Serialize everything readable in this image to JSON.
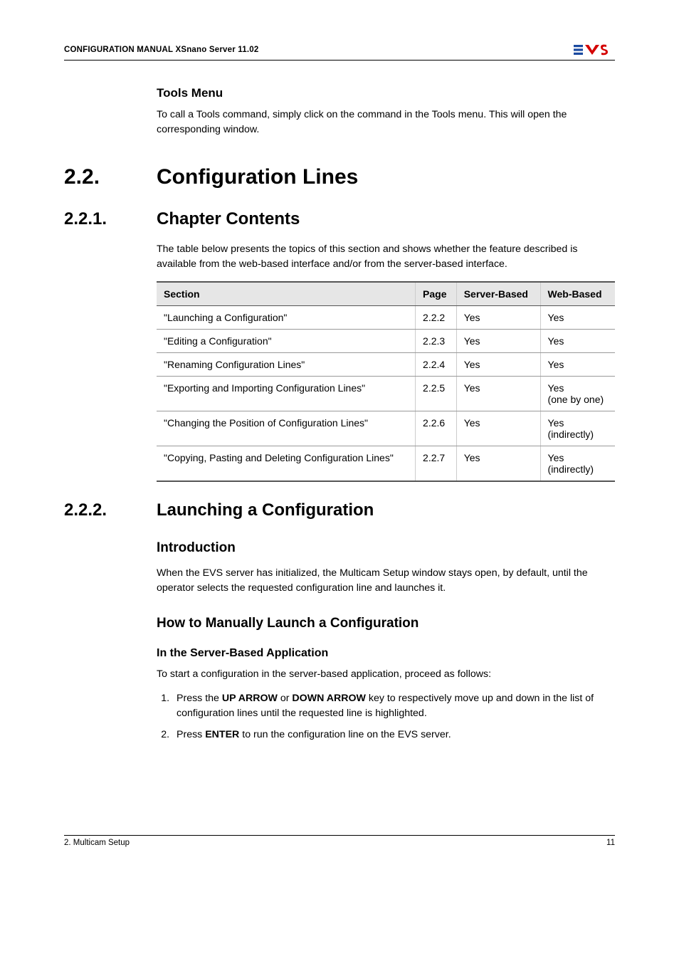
{
  "header": {
    "title": "CONFIGURATION MANUAL  XSnano Server 11.02"
  },
  "tools": {
    "heading": "Tools Menu",
    "body": "To call a Tools command, simply click on the command in the Tools menu. This will open the corresponding window."
  },
  "s22": {
    "num": "2.2.",
    "title": "Configuration Lines"
  },
  "s221": {
    "num": "2.2.1.",
    "title": "Chapter Contents",
    "intro": "The table below presents the topics of this section and shows whether the feature described is available from the web-based interface and/or from the server-based interface.",
    "table": {
      "headers": [
        "Section",
        "Page",
        "Server-Based",
        "Web-Based"
      ],
      "rows": [
        {
          "c0": "\"Launching a Configuration\"",
          "c1": "2.2.2",
          "c2": "Yes",
          "c3": "Yes"
        },
        {
          "c0": "\"Editing a Configuration\"",
          "c1": "2.2.3",
          "c2": "Yes",
          "c3": "Yes"
        },
        {
          "c0": "\"Renaming Configuration Lines\"",
          "c1": "2.2.4",
          "c2": "Yes",
          "c3": "Yes"
        },
        {
          "c0": "\"Exporting and Importing Configuration Lines\"",
          "c1": "2.2.5",
          "c2": "Yes",
          "c3a": "Yes",
          "c3b": "(one by one)"
        },
        {
          "c0": "\"Changing the Position of Configuration Lines\"",
          "c1": "2.2.6",
          "c2": "Yes",
          "c3a": "Yes",
          "c3b": "(indirectly)"
        },
        {
          "c0": "\"Copying, Pasting and Deleting Configuration Lines\"",
          "c1": "2.2.7",
          "c2": "Yes",
          "c3a": "Yes",
          "c3b": "(indirectly)"
        }
      ]
    }
  },
  "s222": {
    "num": "2.2.2.",
    "title": "Launching a Configuration",
    "intro_h": "Introduction",
    "intro_body": "When the EVS server has initialized, the Multicam Setup window stays open, by default, until the operator selects the requested configuration line and launches it.",
    "howto_h": "How to Manually Launch a Configuration",
    "sb_h": "In the Server-Based Application",
    "sb_intro": "To start a configuration in the server-based application, proceed as follows:",
    "step1_a": "Press the ",
    "step1_b": "UP ARROW",
    "step1_c": " or ",
    "step1_d": "DOWN ARROW",
    "step1_e": " key to respectively move up and down in the list of configuration lines until the requested line is highlighted.",
    "step2_a": "Press ",
    "step2_b": "ENTER",
    "step2_c": " to run the configuration line on the EVS server."
  },
  "footer": {
    "left": "2. Multicam Setup",
    "right": "11"
  }
}
